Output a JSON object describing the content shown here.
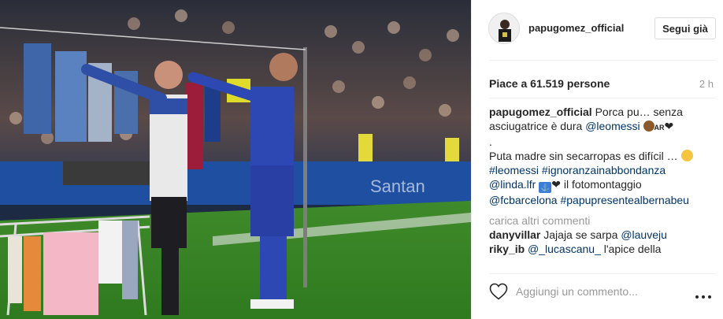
{
  "post": {
    "username": "papugomez_official",
    "follow_label": "Segui già",
    "likes_text": "Piace a 61.519 persone",
    "timestamp": "2 h"
  },
  "caption": {
    "username": "papugomez_official",
    "text_1": "Porca pu… senza asciugatrice è dura",
    "mention_leomessi": "@leomessi",
    "ar_text": "AR",
    "heart": "❤",
    "dot": ".",
    "text_2": "Puta madre sin secarropas es difícil …",
    "hashtag_leomessi": "#leomessi",
    "hashtag_ignoranza": "#ignoranzainabbondanza",
    "mention_linda": "@linda.lfr",
    "text_3": "il fotomontaggio",
    "mention_fcb": "@fcbarcelona",
    "hashtag_papu": "#papupresentealbernabeu"
  },
  "load_more_label": "carica altri commenti",
  "comments": [
    {
      "username": "danyvillar",
      "text": "Jajaja se sarpa ",
      "mention": "@lauveju"
    },
    {
      "username": "riky_ib",
      "text": " l'apice della",
      "mention": "@_lucascanu_"
    }
  ],
  "comment_input": {
    "placeholder": "Aggiungi un commento..."
  },
  "icons": {
    "like": "heart-outline-icon",
    "more": "more-dots-icon"
  },
  "colors": {
    "link": "#003569",
    "muted": "#999999",
    "text": "#262626"
  }
}
